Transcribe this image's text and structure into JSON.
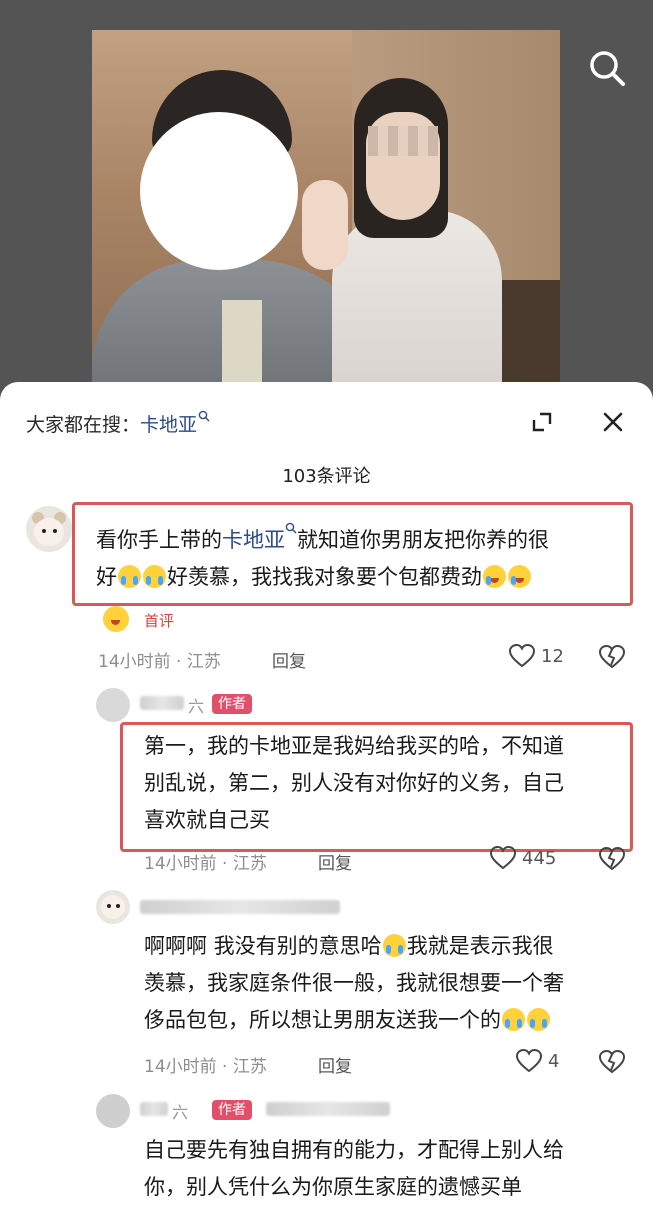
{
  "search_icon": "search-icon",
  "trending": {
    "prefix": "大家都在搜：",
    "keyword": "卡地亚"
  },
  "comment_count_label": "103条评论",
  "comments": [
    {
      "text_before": "看你手上带的",
      "keyword": "卡地亚",
      "text_after": "就知道你男朋友把你养的很",
      "line2_a": "好",
      "line2_b": "好羡慕，我找我对象要个包都费劲",
      "badge": "首评",
      "time_loc": "14小时前 · 江苏",
      "reply": "回复",
      "likes": "12"
    },
    {
      "name_visible": "六",
      "author_tag": "作者",
      "lines": [
        "第一，我的卡地亚是我妈给我买的哈，不知道",
        "别乱说，第二，别人没有对你好的义务，自己",
        "喜欢就自己买"
      ],
      "time_loc": "14小时前 · 江苏",
      "reply": "回复",
      "likes": "445"
    },
    {
      "line1_a": "啊啊啊 我没有别的意思哈",
      "line1_b": "我就是表示我很",
      "line2": "羡慕，我家庭条件很一般，我就很想要一个奢",
      "line3": "侈品包包，所以想让男朋友送我一个的",
      "time_loc": "14小时前 · 江苏",
      "reply": "回复",
      "likes": "4"
    },
    {
      "name_visible": "六",
      "author_tag": "作者",
      "lines": [
        "自己要先有独自拥有的能力，才配得上别人给",
        "你，别人凭什么为你原生家庭的遗憾买单"
      ]
    }
  ],
  "colors": {
    "highlight_box": "#d65a5a",
    "keyword": "#2c4d87",
    "author_tag": "#e0506a",
    "first_badge": "#d0453e"
  }
}
